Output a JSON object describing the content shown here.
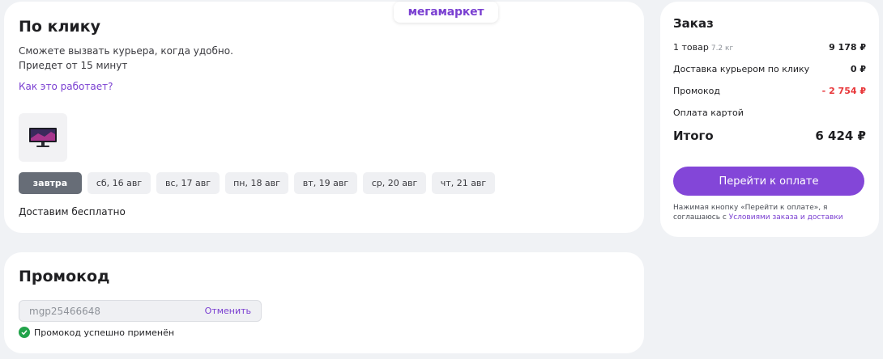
{
  "brand": "мегамаркет",
  "delivery": {
    "title": "По клику",
    "line1": "Сможете вызвать курьера, когда удобно.",
    "line2": "Приедет от 15 минут",
    "how_link": "Как это работает?",
    "dates": [
      "завтра",
      "сб, 16 авг",
      "вс, 17 авг",
      "пн, 18 авг",
      "вт, 19 авг",
      "ср, 20 авг",
      "чт, 21 авг"
    ],
    "selected_date": "завтра",
    "free_text": "Доставим бесплатно"
  },
  "promo": {
    "title": "Промокод",
    "code": "mgp25466648",
    "cancel": "Отменить",
    "status": "Промокод успешно применён"
  },
  "order": {
    "title": "Заказ",
    "items_label": "1 товар",
    "items_weight": "7.2 кг",
    "items_value": "9 178 ₽",
    "delivery_label": "Доставка курьером по клику",
    "delivery_value": "0 ₽",
    "promo_label": "Промокод",
    "promo_value": "- 2 754 ₽",
    "payment_label": "Оплата картой",
    "total_label": "Итого",
    "total_value": "6 424 ₽",
    "pay_button": "Перейти к оплате",
    "note_prefix": "Нажимая кнопку «Перейти к оплате», я соглашаюсь с",
    "note_link": "Условиями заказа и доставки"
  },
  "colors": {
    "accent": "#8346d8",
    "success": "#22a34a",
    "discount": "#e8373a"
  }
}
